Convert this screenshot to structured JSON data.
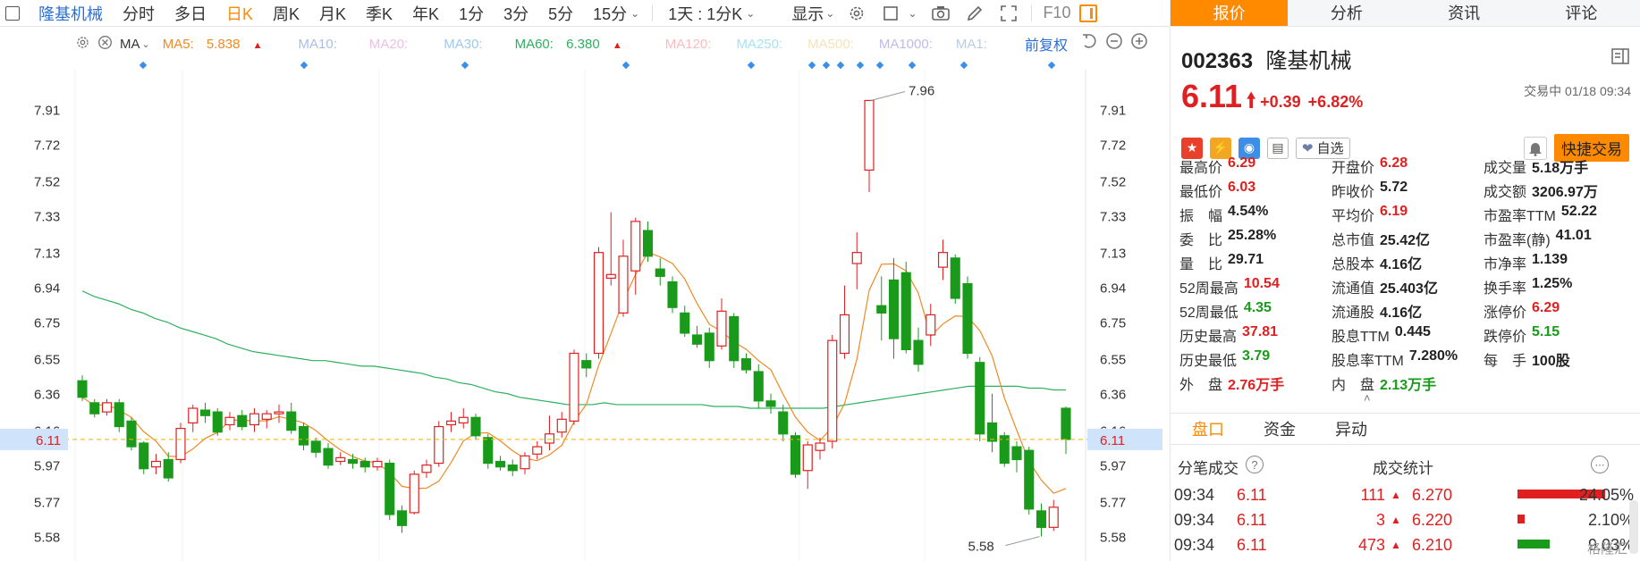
{
  "toolbar": {
    "stock_name": "隆基机械",
    "periods": [
      "分时",
      "多日",
      "日K",
      "周K",
      "月K",
      "季K",
      "年K",
      "1分",
      "3分",
      "5分",
      "15分"
    ],
    "active_period": "日K",
    "combo": "1天 : 1分K",
    "display": "显示",
    "f10": "F10"
  },
  "ma": {
    "label": "MA",
    "ma5_label": "MA5:",
    "ma5_value": "5.838",
    "ma10_label": "MA10:",
    "ma20_label": "MA20:",
    "ma30_label": "MA30:",
    "ma60_label": "MA60:",
    "ma60_value": "6.380",
    "ma120_label": "MA120:",
    "ma250_label": "MA250:",
    "ma500_label": "MA500:",
    "ma1000_label": "MA1000:",
    "ma1_label": "MA1:",
    "adjust": "前复权",
    "colors": {
      "ma5": "#f08a24",
      "ma10": "#7f9ad9",
      "ma20": "#e9a7d8",
      "ma30": "#7fb3e6",
      "ma60": "#2cb05c",
      "ma120": "#f49da0",
      "ma250": "#7fd6ee",
      "ma500": "#f2d38a",
      "ma1000": "#a89de0",
      "ma1": "#9fb5d8"
    }
  },
  "chart_data": {
    "type": "candlestick",
    "ylim": [
      5.5,
      8.05
    ],
    "y_ticks": [
      "7.91",
      "7.72",
      "7.52",
      "7.33",
      "7.13",
      "6.94",
      "6.75",
      "6.55",
      "6.36",
      "6.16",
      "5.97",
      "5.77",
      "5.58"
    ],
    "current_price": "6.11",
    "max_label": "7.96",
    "min_label": "5.58",
    "candles": [
      {
        "o": 6.43,
        "c": 6.34,
        "h": 6.46,
        "l": 6.32
      },
      {
        "o": 6.31,
        "c": 6.25,
        "h": 6.33,
        "l": 6.23
      },
      {
        "o": 6.26,
        "c": 6.31,
        "h": 6.33,
        "l": 6.24
      },
      {
        "o": 6.31,
        "c": 6.18,
        "h": 6.33,
        "l": 6.15
      },
      {
        "o": 6.21,
        "c": 6.07,
        "h": 6.23,
        "l": 6.05
      },
      {
        "o": 6.09,
        "c": 5.95,
        "h": 6.1,
        "l": 5.92
      },
      {
        "o": 5.96,
        "c": 5.99,
        "h": 6.03,
        "l": 5.92
      },
      {
        "o": 6.0,
        "c": 5.9,
        "h": 6.04,
        "l": 5.88
      },
      {
        "o": 6.0,
        "c": 6.17,
        "h": 6.2,
        "l": 5.98
      },
      {
        "o": 6.2,
        "c": 6.28,
        "h": 6.3,
        "l": 6.15
      },
      {
        "o": 6.27,
        "c": 6.24,
        "h": 6.31,
        "l": 6.2
      },
      {
        "o": 6.26,
        "c": 6.15,
        "h": 6.28,
        "l": 6.13
      },
      {
        "o": 6.19,
        "c": 6.23,
        "h": 6.26,
        "l": 6.16
      },
      {
        "o": 6.24,
        "c": 6.18,
        "h": 6.27,
        "l": 6.16
      },
      {
        "o": 6.19,
        "c": 6.25,
        "h": 6.28,
        "l": 6.15
      },
      {
        "o": 6.22,
        "c": 6.25,
        "h": 6.27,
        "l": 6.17
      },
      {
        "o": 6.25,
        "c": 6.26,
        "h": 6.3,
        "l": 6.2
      },
      {
        "o": 6.26,
        "c": 6.16,
        "h": 6.31,
        "l": 6.14
      },
      {
        "o": 6.18,
        "c": 6.08,
        "h": 6.2,
        "l": 6.05
      },
      {
        "o": 6.1,
        "c": 6.04,
        "h": 6.12,
        "l": 6.01
      },
      {
        "o": 6.06,
        "c": 5.97,
        "h": 6.09,
        "l": 5.95
      },
      {
        "o": 5.99,
        "c": 6.01,
        "h": 6.04,
        "l": 5.97
      },
      {
        "o": 6.0,
        "c": 5.98,
        "h": 6.03,
        "l": 5.95
      },
      {
        "o": 5.99,
        "c": 5.96,
        "h": 6.01,
        "l": 5.93
      },
      {
        "o": 5.96,
        "c": 5.99,
        "h": 6.01,
        "l": 5.94
      },
      {
        "o": 5.98,
        "c": 5.7,
        "h": 6.0,
        "l": 5.67
      },
      {
        "o": 5.72,
        "c": 5.64,
        "h": 5.75,
        "l": 5.6
      },
      {
        "o": 5.71,
        "c": 5.92,
        "h": 5.94,
        "l": 5.7
      },
      {
        "o": 5.93,
        "c": 5.97,
        "h": 6.0,
        "l": 5.9
      },
      {
        "o": 5.98,
        "c": 6.18,
        "h": 6.21,
        "l": 5.96
      },
      {
        "o": 6.19,
        "c": 6.21,
        "h": 6.26,
        "l": 6.15
      },
      {
        "o": 6.2,
        "c": 6.23,
        "h": 6.28,
        "l": 6.17
      },
      {
        "o": 6.23,
        "c": 6.13,
        "h": 6.25,
        "l": 6.11
      },
      {
        "o": 6.12,
        "c": 5.98,
        "h": 6.14,
        "l": 5.95
      },
      {
        "o": 5.99,
        "c": 5.96,
        "h": 6.02,
        "l": 5.94
      },
      {
        "o": 5.97,
        "c": 5.94,
        "h": 6.0,
        "l": 5.91
      },
      {
        "o": 5.95,
        "c": 6.02,
        "h": 6.04,
        "l": 5.92
      },
      {
        "o": 6.03,
        "c": 6.07,
        "h": 6.1,
        "l": 6.0
      },
      {
        "o": 6.09,
        "c": 6.14,
        "h": 6.24,
        "l": 6.05
      },
      {
        "o": 6.15,
        "c": 6.22,
        "h": 6.26,
        "l": 6.12
      },
      {
        "o": 6.21,
        "c": 6.58,
        "h": 6.6,
        "l": 6.19
      },
      {
        "o": 6.54,
        "c": 6.5,
        "h": 6.58,
        "l": 6.45
      },
      {
        "o": 6.58,
        "c": 7.13,
        "h": 7.16,
        "l": 6.55
      },
      {
        "o": 6.99,
        "c": 7.01,
        "h": 7.35,
        "l": 6.95
      },
      {
        "o": 6.8,
        "c": 7.11,
        "h": 7.2,
        "l": 6.78
      },
      {
        "o": 7.03,
        "c": 7.3,
        "h": 7.32,
        "l": 6.9
      },
      {
        "o": 7.25,
        "c": 7.11,
        "h": 7.3,
        "l": 7.08
      },
      {
        "o": 7.04,
        "c": 7.0,
        "h": 7.1,
        "l": 6.95
      },
      {
        "o": 6.97,
        "c": 6.83,
        "h": 7.0,
        "l": 6.8
      },
      {
        "o": 6.8,
        "c": 6.69,
        "h": 6.84,
        "l": 6.67
      },
      {
        "o": 6.68,
        "c": 6.63,
        "h": 6.73,
        "l": 6.61
      },
      {
        "o": 6.69,
        "c": 6.54,
        "h": 6.72,
        "l": 6.5
      },
      {
        "o": 6.62,
        "c": 6.81,
        "h": 6.88,
        "l": 6.6
      },
      {
        "o": 6.78,
        "c": 6.54,
        "h": 6.8,
        "l": 6.5
      },
      {
        "o": 6.55,
        "c": 6.49,
        "h": 6.58,
        "l": 6.47
      },
      {
        "o": 6.48,
        "c": 6.32,
        "h": 6.52,
        "l": 6.28
      },
      {
        "o": 6.32,
        "c": 6.29,
        "h": 6.36,
        "l": 6.25
      },
      {
        "o": 6.26,
        "c": 6.14,
        "h": 6.3,
        "l": 6.1
      },
      {
        "o": 6.13,
        "c": 5.92,
        "h": 6.15,
        "l": 5.9
      },
      {
        "o": 5.94,
        "c": 6.08,
        "h": 6.1,
        "l": 5.84
      },
      {
        "o": 6.05,
        "c": 6.09,
        "h": 6.12,
        "l": 6.0
      },
      {
        "o": 6.1,
        "c": 6.65,
        "h": 6.68,
        "l": 6.06
      },
      {
        "o": 6.58,
        "c": 6.79,
        "h": 6.95,
        "l": 6.55
      },
      {
        "o": 7.07,
        "c": 7.13,
        "h": 7.24,
        "l": 6.93
      },
      {
        "o": 7.58,
        "c": 7.96,
        "h": 7.96,
        "l": 7.46
      },
      {
        "o": 6.84,
        "c": 6.8,
        "h": 7.0,
        "l": 6.65
      },
      {
        "o": 6.98,
        "c": 6.66,
        "h": 7.1,
        "l": 6.55
      },
      {
        "o": 7.02,
        "c": 6.6,
        "h": 7.08,
        "l": 6.58
      },
      {
        "o": 6.65,
        "c": 6.52,
        "h": 6.72,
        "l": 6.48
      },
      {
        "o": 6.68,
        "c": 6.79,
        "h": 6.85,
        "l": 6.62
      },
      {
        "o": 7.05,
        "c": 7.13,
        "h": 7.2,
        "l": 6.98
      },
      {
        "o": 7.1,
        "c": 6.88,
        "h": 7.12,
        "l": 6.85
      },
      {
        "o": 6.96,
        "c": 6.58,
        "h": 7.0,
        "l": 6.55
      },
      {
        "o": 6.53,
        "c": 6.14,
        "h": 6.56,
        "l": 6.1
      },
      {
        "o": 6.2,
        "c": 6.1,
        "h": 6.36,
        "l": 6.04
      },
      {
        "o": 6.13,
        "c": 5.98,
        "h": 6.15,
        "l": 5.96
      },
      {
        "o": 6.07,
        "c": 6.0,
        "h": 6.1,
        "l": 5.93
      },
      {
        "o": 6.05,
        "c": 5.73,
        "h": 6.07,
        "l": 5.7
      },
      {
        "o": 5.72,
        "c": 5.63,
        "h": 5.76,
        "l": 5.58
      },
      {
        "o": 5.63,
        "c": 5.74,
        "h": 5.78,
        "l": 5.61
      },
      {
        "o": 6.28,
        "c": 6.11,
        "h": 6.29,
        "l": 6.03
      }
    ],
    "ma60_points": [
      6.92,
      6.89,
      6.87,
      6.85,
      6.82,
      6.8,
      6.77,
      6.75,
      6.72,
      6.7,
      6.68,
      6.66,
      6.63,
      6.61,
      6.59,
      6.58,
      6.57,
      6.56,
      6.55,
      6.54,
      6.54,
      6.53,
      6.52,
      6.51,
      6.51,
      6.5,
      6.49,
      6.48,
      6.47,
      6.45,
      6.44,
      6.42,
      6.41,
      6.39,
      6.37,
      6.36,
      6.34,
      6.33,
      6.32,
      6.31,
      6.3,
      6.3,
      6.3,
      6.31,
      6.3,
      6.3,
      6.3,
      6.3,
      6.3,
      6.3,
      6.3,
      6.3,
      6.29,
      6.29,
      6.29,
      6.28,
      6.28,
      6.28,
      6.28,
      6.28,
      6.28,
      6.28,
      6.29,
      6.3,
      6.31,
      6.32,
      6.33,
      6.34,
      6.35,
      6.36,
      6.37,
      6.38,
      6.39,
      6.4,
      6.4,
      6.4,
      6.4,
      6.4,
      6.39,
      6.39,
      6.38,
      6.38
    ]
  },
  "panel": {
    "tabs": [
      "报价",
      "分析",
      "资讯",
      "评论"
    ],
    "code": "002363",
    "name": "隆基机械",
    "price": "6.11",
    "change": "+0.39",
    "pct": "+6.82%",
    "trade_time": "交易中 01/18 09:34",
    "fav": "自选",
    "quick_trade": "快捷交易",
    "stats": [
      [
        {
          "k": "最高价",
          "v": "6.29",
          "c": "red"
        },
        {
          "k": "开盘价",
          "v": "6.28",
          "c": "red"
        },
        {
          "k": "成交量",
          "v": "5.18万手",
          "c": "dark"
        }
      ],
      [
        {
          "k": "最低价",
          "v": "6.03",
          "c": "red"
        },
        {
          "k": "昨收价",
          "v": "5.72",
          "c": "dark"
        },
        {
          "k": "成交额",
          "v": "3206.97万",
          "c": "dark"
        }
      ],
      [
        {
          "k": "振　幅",
          "v": "4.54%",
          "c": "dark"
        },
        {
          "k": "平均价",
          "v": "6.19",
          "c": "red"
        },
        {
          "k": "市盈率TTM",
          "v": "52.22",
          "c": "dark"
        }
      ],
      [
        {
          "k": "委　比",
          "v": "25.28%",
          "c": "dark"
        },
        {
          "k": "总市值",
          "v": "25.42亿",
          "c": "dark"
        },
        {
          "k": "市盈率(静)",
          "v": "41.01",
          "c": "dark"
        }
      ],
      [
        {
          "k": "量　比",
          "v": "29.71",
          "c": "dark"
        },
        {
          "k": "总股本",
          "v": "4.16亿",
          "c": "dark"
        },
        {
          "k": "市净率",
          "v": "1.139",
          "c": "dark"
        }
      ],
      [
        {
          "k": "52周最高",
          "v": "10.54",
          "c": "red"
        },
        {
          "k": "流通值",
          "v": "25.403亿",
          "c": "dark"
        },
        {
          "k": "换手率",
          "v": "1.25%",
          "c": "dark"
        }
      ],
      [
        {
          "k": "52周最低",
          "v": "4.35",
          "c": "green"
        },
        {
          "k": "流通股",
          "v": "4.16亿",
          "c": "dark"
        },
        {
          "k": "涨停价",
          "v": "6.29",
          "c": "red"
        }
      ],
      [
        {
          "k": "历史最高",
          "v": "37.81",
          "c": "red"
        },
        {
          "k": "股息TTM",
          "v": "0.445",
          "c": "dark"
        },
        {
          "k": "跌停价",
          "v": "5.15",
          "c": "green"
        }
      ],
      [
        {
          "k": "历史最低",
          "v": "3.79",
          "c": "green"
        },
        {
          "k": "股息率TTM",
          "v": "7.280%",
          "c": "dark"
        },
        {
          "k": "每　手",
          "v": "100股",
          "c": "dark"
        }
      ],
      [
        {
          "k": "外　盘",
          "v": "2.76万手",
          "c": "red"
        },
        {
          "k": "内　盘",
          "v": "2.13万手",
          "c": "green"
        },
        {
          "k": "",
          "v": "",
          "c": "dark"
        }
      ]
    ],
    "subtabs": [
      "盘口",
      "资金",
      "异动"
    ],
    "ticks_title": "分笔成交",
    "stats_title": "成交统计",
    "ticks": [
      {
        "t": "09:34",
        "p": "6.11",
        "v": "111",
        "sp": "6.270",
        "pct": "24.05%",
        "bar": 0.82,
        "bc": "#e02020"
      },
      {
        "t": "09:34",
        "p": "6.11",
        "v": "3",
        "sp": "6.220",
        "pct": "2.10%",
        "bar": 0.07,
        "bc": "#e02020"
      },
      {
        "t": "09:34",
        "p": "6.11",
        "v": "473",
        "sp": "6.210",
        "pct": "9.03%",
        "bar": 0.3,
        "bc": "#1a9a1a"
      }
    ],
    "watermark": "格隆汇"
  }
}
